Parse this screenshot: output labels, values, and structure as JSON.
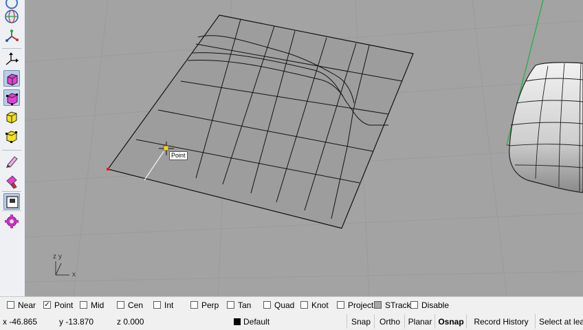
{
  "toolbar": {
    "buttons": [
      {
        "name": "rotate-view-icon",
        "active": false
      },
      {
        "name": "globe-icon",
        "active": false
      },
      {
        "name": "axis-icon",
        "active": false
      },
      {
        "name": "move-gumball-icon",
        "active": false
      },
      {
        "name": "box-pink-icon",
        "active": true
      },
      {
        "name": "box-pink-points-icon",
        "active": true
      },
      {
        "name": "box-yellow-icon",
        "active": false
      },
      {
        "name": "box-yellow-points-icon",
        "active": false
      },
      {
        "name": "pen-icon",
        "active": false
      },
      {
        "name": "brush-icon",
        "active": false
      },
      {
        "name": "window-toggle-icon",
        "active": true
      },
      {
        "name": "gear-cog-icon",
        "active": false
      }
    ]
  },
  "viewport": {
    "osnap_tooltip": "Point",
    "axis_labels": {
      "x": "x",
      "y": "y",
      "z": "z"
    },
    "colors": {
      "background": "#a3a3a3",
      "grid": "#999999",
      "surface": "#9d9d9d",
      "y_axis": "#22b04c",
      "x_axis": "#c11a1a"
    }
  },
  "osnap": [
    {
      "label": "Near",
      "checked": false
    },
    {
      "label": "Point",
      "checked": true
    },
    {
      "label": "Mid",
      "checked": false
    },
    {
      "label": "Cen",
      "checked": false
    },
    {
      "label": "Int",
      "checked": false
    },
    {
      "label": "Perp",
      "checked": false
    },
    {
      "label": "Tan",
      "checked": false
    },
    {
      "label": "Quad",
      "checked": false
    },
    {
      "label": "Knot",
      "checked": false
    },
    {
      "label": "Project",
      "checked": false
    },
    {
      "label": "STrack",
      "checked": false,
      "shaded": true
    },
    {
      "label": "Disable",
      "checked": false
    }
  ],
  "status": {
    "x": "x -46.865",
    "y": "y -13.870",
    "z": "z 0.000",
    "layer": "Default",
    "panes": [
      "Snap",
      "Ortho",
      "Planar",
      "Osnap",
      "Record History",
      "Select at leas"
    ],
    "bold_pane": "Osnap"
  }
}
